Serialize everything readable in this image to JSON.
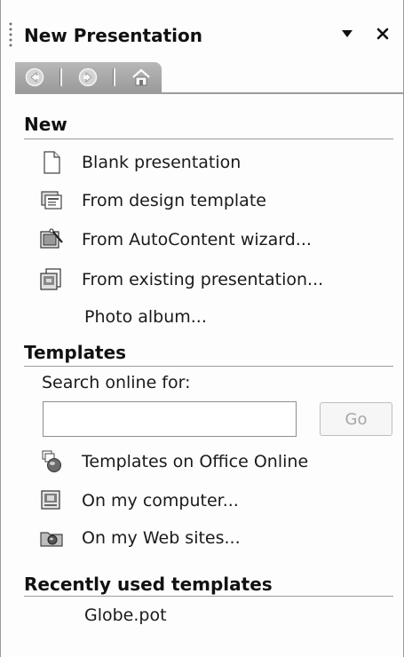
{
  "pane": {
    "title": "New Presentation",
    "menu_icon": "dropdown-arrow-icon",
    "close_icon": "close-icon"
  },
  "nav": {
    "back_icon": "back-arrow-icon",
    "forward_icon": "forward-arrow-icon",
    "home_icon": "home-icon"
  },
  "new_section": {
    "title": "New",
    "items": [
      {
        "label": "Blank presentation",
        "icon": "blank-document-icon"
      },
      {
        "label": "From design template",
        "icon": "design-template-icon"
      },
      {
        "label": "From AutoContent wizard...",
        "icon": "autocontent-wizard-icon"
      },
      {
        "label": "From existing presentation...",
        "icon": "existing-presentation-icon"
      },
      {
        "label": "Photo album..."
      }
    ]
  },
  "templates_section": {
    "title": "Templates",
    "search_label": "Search online for:",
    "search_value": "",
    "go_label": "Go",
    "items": [
      {
        "label": "Templates on Office Online",
        "icon": "office-online-icon"
      },
      {
        "label": "On my computer...",
        "icon": "my-computer-template-icon"
      },
      {
        "label": "On my Web sites...",
        "icon": "web-sites-icon"
      }
    ]
  },
  "recent_section": {
    "title": "Recently used templates",
    "items": [
      {
        "label": "Globe.pot"
      }
    ]
  }
}
